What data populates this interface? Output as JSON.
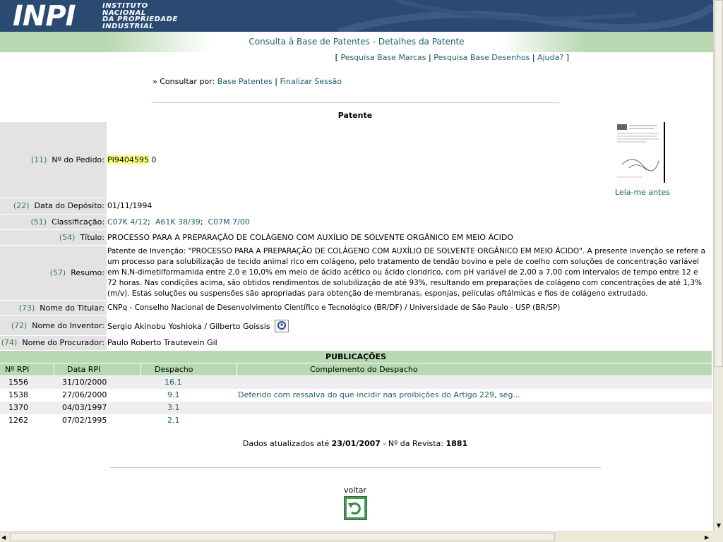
{
  "header": {
    "logo_mark": "INPI",
    "logo_lines": [
      "INSTITUTO",
      "NACIONAL",
      "DA PROPRIEDADE",
      "INDUSTRIAL"
    ],
    "page_title": "Consulta à Base de Patentes - Detalhes da Patente"
  },
  "topnav": {
    "open": "[",
    "close": "]",
    "links": [
      "Pesquisa Base Marcas",
      "Pesquisa Base Desenhos",
      "Ajuda?"
    ],
    "separator": "|"
  },
  "consult": {
    "prefix": "» Consultar por:",
    "links": [
      "Base Patentes",
      "Finalizar Sessão"
    ],
    "separator": "|"
  },
  "section_title": "Patente",
  "fields": {
    "pedido": {
      "code": "(11)",
      "label": "Nº do Pedido:",
      "value_highlight": "PI9404595",
      "value_rest": " 0"
    },
    "deposito": {
      "code": "(22)",
      "label": "Data do Depósito:",
      "value": "01/11/1994"
    },
    "classificacao": {
      "code": "(51)",
      "label": "Classificação:",
      "items": [
        "C07K 4/12",
        "A61K 38/39",
        "C07M 7/00"
      ],
      "separator": ";"
    },
    "titulo": {
      "code": "(54)",
      "label": "Título:",
      "value": "PROCESSO PARA A PREPARAÇÃO DE COLÁGENO COM AUXÍLIO DE SOLVENTE ORGÂNICO EM MEIO ÁCIDO"
    },
    "resumo": {
      "code": "(57)",
      "label": "Resumo:",
      "value": "Patente de Invenção: \"PROCESSO PARA A PREPARAÇÃO DE COLÁGENO COM AUXÍLIO DE SOLVENTE ORGÂNICO EM MEIO ÁCIDO\". A presente invenção se refere a um processo para solubilização de tecido animal rico em colágeno, pelo tratamento de tendão bovino e pele de coelho com soluções de concentração variável em N,N-dimetilformamida entre 2,0 e 10,0% em meio de ácido acético ou ácido cloridrico, com pH variável de 2,00 a 7,00 com intervalos de tempo entre 12 e 72 horas. Nas condições acima, são obtidos rendimentos de solubilização de até 93%, resultando em preparações de colágeno com concentrações de até 1,3% (m/v). Estas soluções ou suspensões são apropriadas para obtenção de membranas, esponjas, películas oftálmicas e fios de colágeno extrudado."
    },
    "titular": {
      "code": "(73)",
      "label": "Nome do Titular:",
      "value": "CNPq - Conselho Nacional de Desenvolvimento Científico e Tecnológico (BR/DF) / Universidade de São Paulo - USP (BR/SP)"
    },
    "inventor": {
      "code": "(72)",
      "label": "Nome do Inventor:",
      "value": "Sergio Akinobu Yoshioka / Gilberto Goissis"
    },
    "procurador": {
      "code": "(74)",
      "label": "Nome do Procurador:",
      "value": "Paulo Roberto Trautevein Gil"
    }
  },
  "leiame": {
    "label": "Leia-me antes"
  },
  "publicacoes": {
    "title": "PUBLICAÇÕES",
    "columns": [
      "Nº RPI",
      "Data RPI",
      "Despacho",
      "Complemento do Despacho"
    ],
    "rows": [
      {
        "rpi": "1556",
        "data": "31/10/2000",
        "despacho": "16.1",
        "complemento": ""
      },
      {
        "rpi": "1538",
        "data": "27/06/2000",
        "despacho": "9.1",
        "complemento": "Deferido com ressalva do que incidir nas proibições do Artigo 229, seg..."
      },
      {
        "rpi": "1370",
        "data": "04/03/1997",
        "despacho": "3.1",
        "complemento": ""
      },
      {
        "rpi": "1262",
        "data": "07/02/1995",
        "despacho": "2.1",
        "complemento": ""
      }
    ]
  },
  "footer": {
    "updated_prefix": "Dados atualizados até",
    "updated_date": "23/01/2007",
    "revista_prefix": "- Nº da Revista:",
    "revista_num": "1881",
    "voltar": "voltar"
  }
}
